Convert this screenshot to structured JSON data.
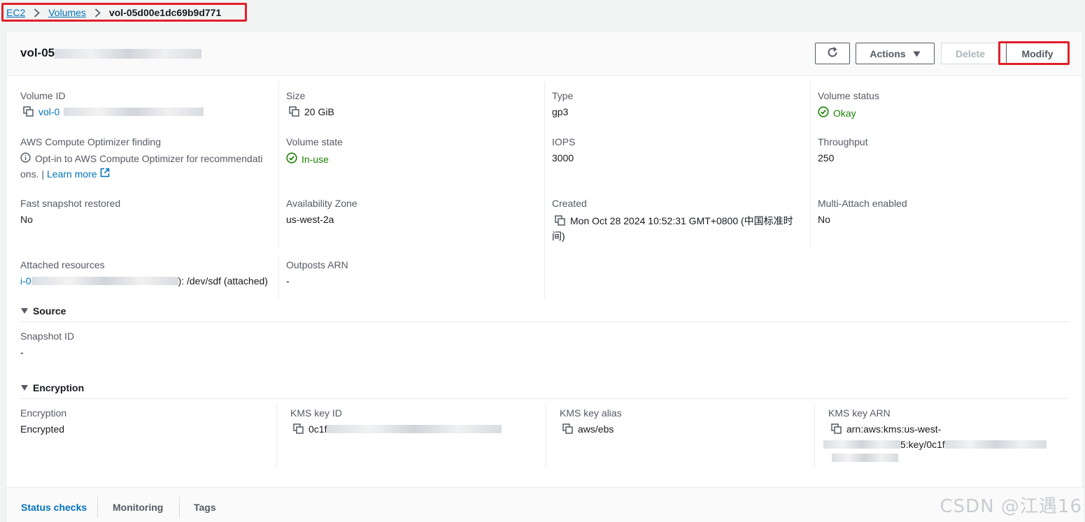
{
  "breadcrumb": {
    "items": [
      "EC2",
      "Volumes"
    ],
    "current": "vol-05d00e1dc69b9d771"
  },
  "header": {
    "title": "vol-05",
    "refresh_icon": "refresh-icon",
    "actions_label": "Actions",
    "delete_label": "Delete",
    "modify_label": "Modify"
  },
  "details": {
    "volume_id_label": "Volume ID",
    "volume_id_value": "vol-0",
    "size_label": "Size",
    "size_value": "20 GiB",
    "type_label": "Type",
    "type_value": "gp3",
    "volume_status_label": "Volume status",
    "volume_status_value": "Okay",
    "optimizer_label": "AWS Compute Optimizer finding",
    "optimizer_text_1": "Opt-in to AWS Compute Optimizer for recommendati",
    "optimizer_text_2": "ons. |",
    "learn_more": "Learn more",
    "volume_state_label": "Volume state",
    "volume_state_value": "In-use",
    "iops_label": "IOPS",
    "iops_value": "3000",
    "throughput_label": "Throughput",
    "throughput_value": "250",
    "fast_snapshot_label": "Fast snapshot restored",
    "fast_snapshot_value": "No",
    "az_label": "Availability Zone",
    "az_value": "us-west-2a",
    "created_label": "Created",
    "created_value_1": "Mon Oct 28 2024 10:52:31 GMT+0800 (中国标准时",
    "created_value_2": "间)",
    "multi_attach_label": "Multi-Attach enabled",
    "multi_attach_value": "No",
    "attached_label": "Attached resources",
    "attached_link": "i-0",
    "attached_suffix": "): /dev/sdf (attached)",
    "outposts_label": "Outposts ARN",
    "outposts_value": "-"
  },
  "source": {
    "heading": "Source",
    "snapshot_label": "Snapshot ID",
    "snapshot_value": "-"
  },
  "encryption": {
    "heading": "Encryption",
    "encryption_label": "Encryption",
    "encryption_value": "Encrypted",
    "kms_id_label": "KMS key ID",
    "kms_id_value": "0c1f",
    "kms_alias_label": "KMS key alias",
    "kms_alias_value": "aws/ebs",
    "kms_arn_label": "KMS key ARN",
    "kms_arn_value_1": "arn:aws:kms:us-west-",
    "kms_arn_value_2": "5:key/0c1f"
  },
  "tabs": [
    "Status checks",
    "Monitoring",
    "Tags"
  ],
  "watermark": "CSDN @江遇16",
  "colors": {
    "link": "#0073bb",
    "success": "#1d8102",
    "highlight": "#e0202a"
  }
}
